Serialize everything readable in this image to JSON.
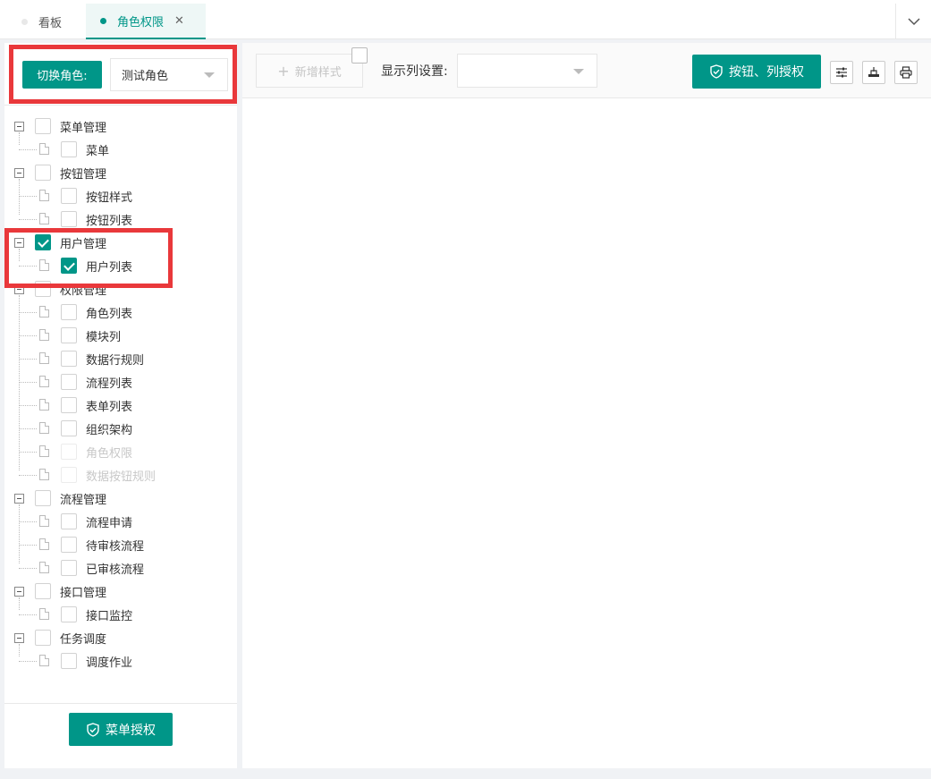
{
  "tabs": [
    {
      "label": "看板",
      "active": false
    },
    {
      "label": "角色权限",
      "active": true
    }
  ],
  "role": {
    "label": "切换角色:",
    "selected": "测试角色"
  },
  "tree": [
    {
      "label": "菜单管理",
      "checked": false,
      "children": [
        {
          "label": "菜单",
          "checked": false
        }
      ]
    },
    {
      "label": "按钮管理",
      "checked": false,
      "children": [
        {
          "label": "按钮样式",
          "checked": false
        },
        {
          "label": "按钮列表",
          "checked": false
        }
      ]
    },
    {
      "label": "用户管理",
      "checked": true,
      "children": [
        {
          "label": "用户列表",
          "checked": true
        }
      ]
    },
    {
      "label": "权限管理",
      "checked": false,
      "children": [
        {
          "label": "角色列表",
          "checked": false
        },
        {
          "label": "模块列",
          "checked": false
        },
        {
          "label": "数据行规则",
          "checked": false
        },
        {
          "label": "流程列表",
          "checked": false
        },
        {
          "label": "表单列表",
          "checked": false
        },
        {
          "label": "组织架构",
          "checked": false
        },
        {
          "label": "角色权限",
          "checked": false,
          "disabled": true
        },
        {
          "label": "数据按钮规则",
          "checked": false,
          "disabled": true
        }
      ]
    },
    {
      "label": "流程管理",
      "checked": false,
      "children": [
        {
          "label": "流程申请",
          "checked": false
        },
        {
          "label": "待审核流程",
          "checked": false
        },
        {
          "label": "已审核流程",
          "checked": false
        }
      ]
    },
    {
      "label": "接口管理",
      "checked": false,
      "children": [
        {
          "label": "接口监控",
          "checked": false
        }
      ]
    },
    {
      "label": "任务调度",
      "checked": false,
      "children": [
        {
          "label": "调度作业",
          "checked": false
        }
      ]
    }
  ],
  "footer": {
    "menu_auth_label": "菜单授权"
  },
  "toolbar": {
    "add_style_label": "新增样式",
    "column_setting_label": "显示列设置:",
    "column_setting_value": "",
    "grant_label": "按钮、列授权"
  },
  "icons": {
    "shield": "shield-icon",
    "sliders": "sliders-icon",
    "export": "export-icon",
    "print": "print-icon",
    "chevron": "chevron-down-icon"
  },
  "colors": {
    "accent": "#009688",
    "highlight": "#e9383b"
  }
}
